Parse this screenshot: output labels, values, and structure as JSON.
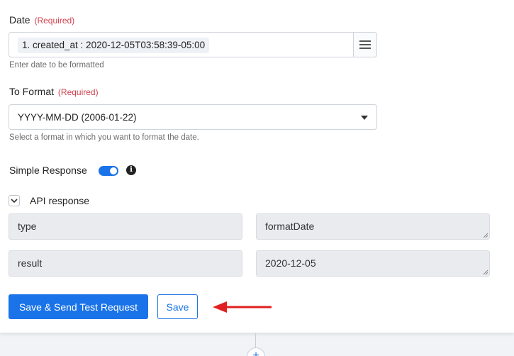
{
  "date": {
    "label": "Date",
    "required": "(Required)",
    "token": "1. created_at : 2020-12-05T03:58:39-05:00",
    "hint": "Enter date to be formatted",
    "menu_icon": "hamburger-menu-icon"
  },
  "to_format": {
    "label": "To Format",
    "required": "(Required)",
    "selected": "YYYY-MM-DD (2006-01-22)",
    "hint": "Select a format in which you want to format the date."
  },
  "simple_response": {
    "label": "Simple Response",
    "enabled": true,
    "info_icon": "info-icon"
  },
  "api_response": {
    "label": "API response",
    "rows": [
      {
        "key": "type",
        "value": "formatDate"
      },
      {
        "key": "result",
        "value": "2020-12-05"
      }
    ]
  },
  "actions": {
    "save_send_label": "Save & Send Test Request",
    "save_label": "Save"
  },
  "colors": {
    "accent": "#1a73e8",
    "required": "#d0414e",
    "arrow": "#e02020"
  }
}
